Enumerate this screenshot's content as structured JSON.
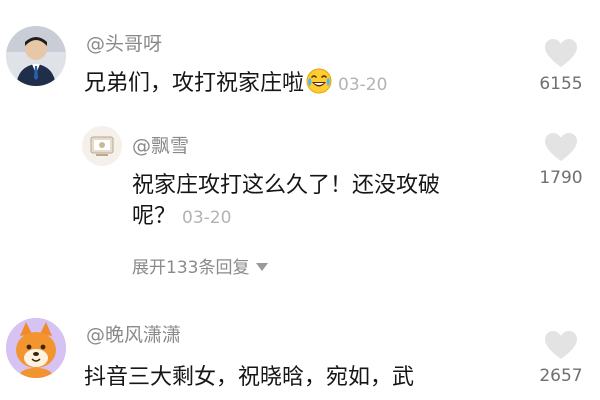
{
  "colors": {
    "username": "#8a8a8a",
    "text": "#161616",
    "time": "#b3b3b3",
    "heart": "#e3e3e3",
    "count": "#6f6f6f"
  },
  "comments": [
    {
      "username": "@头哥呀",
      "text": "兄弟们，攻打祝家庄啦",
      "emoji": "tears-of-joy-emoji-icon",
      "time": "03-20",
      "likes": "6155"
    },
    {
      "username": "@飘雪",
      "text_line1": "祝家庄攻打这么久了！还没攻破",
      "text_line2": "呢？",
      "time": "03-20",
      "likes": "1790"
    },
    {
      "username": "@晚风潇潇",
      "text": "抖音三大剩女，祝晓晗，宛如，武",
      "likes": "2657"
    }
  ],
  "expand_replies": "展开133条回复"
}
